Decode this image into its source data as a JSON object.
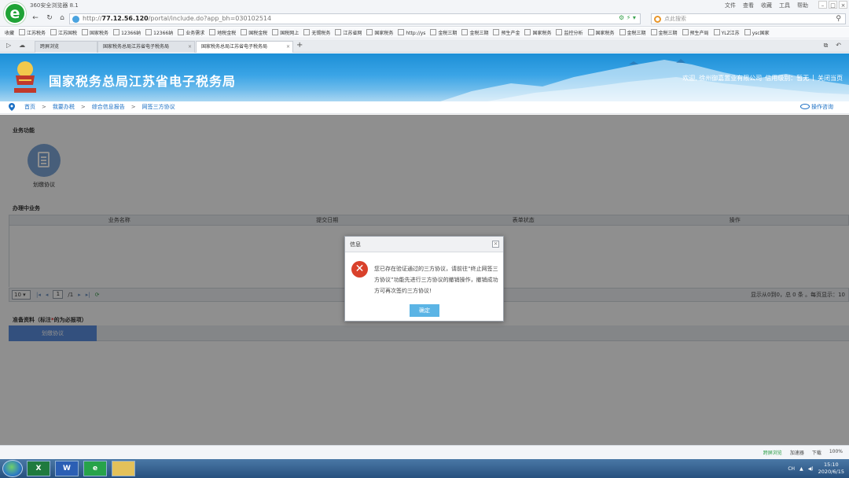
{
  "browser": {
    "title": "360安全浏览器 8.1",
    "menu": [
      "文件",
      "查看",
      "收藏",
      "工具",
      "帮助"
    ],
    "url_host": "77.12.56.120",
    "url_prefix": "http://",
    "url_path": "/portal/include.do?app_bh=030102514",
    "search_placeholder": "点此搜索",
    "bookmarks": [
      "收藏",
      "江苏税务",
      "江苏国税",
      "国家税务",
      "12366纳",
      "12366纳",
      "业务需求",
      "地税金税",
      "国税金税",
      "国税网上",
      "无锡税务",
      "江苏省网",
      "国家税务",
      "http://ys",
      "金税三期",
      "金税三期",
      "预生产金",
      "国家税务",
      "监控分析",
      "国家税务",
      "金税三期",
      "金税三期",
      "预生产局",
      "YLZ江苏",
      "ysc国家"
    ],
    "tabs": [
      {
        "label": "跨屏浏览"
      },
      {
        "label": "国家税务总局江苏省电子税务局",
        "close": "×"
      },
      {
        "label": "国家税务总局江苏省电子税务局",
        "close": "×"
      }
    ],
    "new_tab": "+"
  },
  "site": {
    "title": "国家税务总局江苏省电子税务局",
    "welcome": "欢迎, 徐州御嘉置业有限公司",
    "credit": "信用级别：暂无",
    "sep": "|",
    "close_page": "关闭当页"
  },
  "breadcrumb": {
    "items": [
      "首页",
      "我要办税",
      "综合信息报告",
      "网签三方协议"
    ],
    "sep": ">",
    "help": "操作咨询"
  },
  "business": {
    "section_title": "业务功能",
    "func_label": "划缴协议"
  },
  "pending": {
    "section_title": "办理中业务",
    "columns": [
      "业务名称",
      "提交日期",
      "表单状态",
      "操作"
    ],
    "page_size": "10",
    "page_current": "1",
    "page_total": "/1",
    "page_info": "显示从0到0，总 0 条 。每页显示：10"
  },
  "prep": {
    "title_prefix": "准备资料（标注",
    "title_star": "*",
    "title_suffix": "的为必报项）",
    "tab_label": "划缴协议"
  },
  "dialog": {
    "title": "信息",
    "close": "×",
    "message": "您已存在验证通过的三方协议，请前往“终止网签三方协议”功能先进行三方协议的撤销操作，撤销成功方可再次签约三方协议!",
    "ok": "确定"
  },
  "statusbar": {
    "items": [
      "跨屏浏览",
      "加速器",
      "下载",
      "100%"
    ]
  },
  "taskbar": {
    "ime": "CH",
    "time": "15:10",
    "date": "2020/6/15"
  }
}
